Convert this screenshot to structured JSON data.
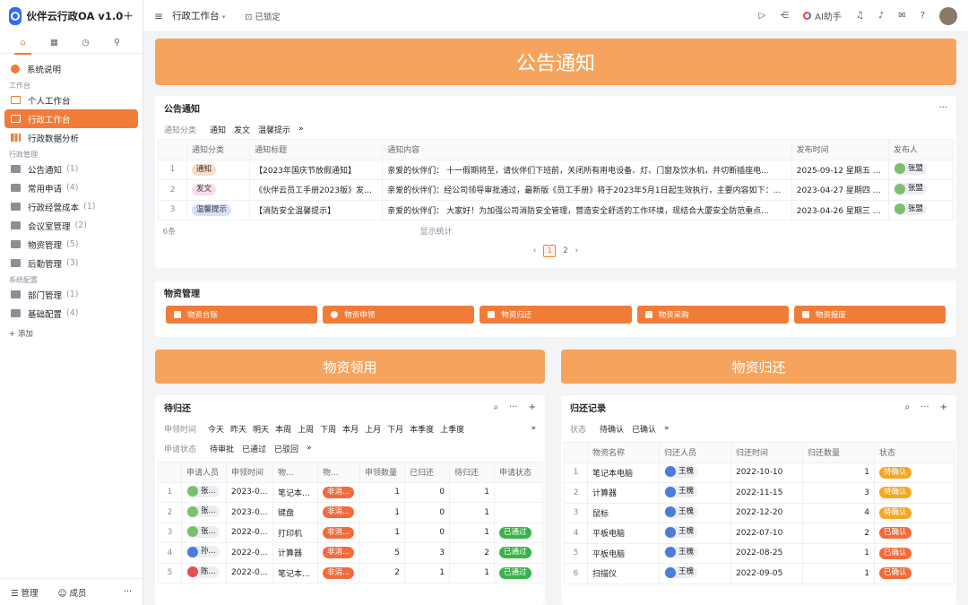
{
  "app": {
    "title": "伙伴云行政OA v1.0"
  },
  "sidebar": {
    "items": [
      {
        "label": "系统说明",
        "count": ""
      },
      {
        "label": "个人工作台",
        "count": ""
      },
      {
        "label": "行政工作台",
        "count": ""
      },
      {
        "label": "行政数据分析",
        "count": ""
      },
      {
        "label": "公告通知",
        "count": "(1)"
      },
      {
        "label": "常用申请",
        "count": "(4)"
      },
      {
        "label": "行政经营成本",
        "count": "(1)"
      },
      {
        "label": "会议室管理",
        "count": "(2)"
      },
      {
        "label": "物资管理",
        "count": "(5)"
      },
      {
        "label": "后勤管理",
        "count": "(3)"
      },
      {
        "label": "部门管理",
        "count": "(1)"
      },
      {
        "label": "基础配置",
        "count": "(4)"
      }
    ],
    "sections": [
      "工作台",
      "行政管理",
      "系统配置"
    ],
    "add": "+ 添加",
    "footer": {
      "manage": "管理",
      "members": "成员",
      "more": "···"
    }
  },
  "topbar": {
    "title": "行政工作台",
    "lock": "已锁定",
    "ai": "AI助手"
  },
  "banners": {
    "notice": "公告通知",
    "receive": "物资领用",
    "return": "物资归还"
  },
  "notice": {
    "title": "公告通知",
    "more": "···",
    "filter_label": "通知分类",
    "filters": [
      "通知",
      "发文",
      "温馨提示"
    ],
    "chev": "»",
    "headers": [
      "通知分类",
      "通知标题",
      "通知内容",
      "发布时间",
      "发布人"
    ],
    "rows": [
      {
        "n": "1",
        "cat": "通知",
        "title": "【2023年国庆节放假通知】",
        "content": "亲爱的伙伴们：     十一假期将至，请伙伴们下班前，关闭所有用电设备、灯、门窗及饮水机，并切断插座电...",
        "time": "2025-09-12 星期五 0...",
        "user": "张盟"
      },
      {
        "n": "2",
        "cat": "发文",
        "title": "《伙伴云员工手册2023版》发布...",
        "content": "亲爱的伙伴们：经公司领导审批通过，最新版《员工手册》将于2023年5月1日起生效执行，主要内容如下：...",
        "time": "2023-04-27 星期四 1...",
        "user": "张盟"
      },
      {
        "n": "3",
        "cat": "温馨提示",
        "title": "【消防安全温馨提示】",
        "content": "亲爱的伙伴们：     大家好！为加强公司消防安全管理，营造安全舒适的工作环境，现结合大厦安全防范重点...",
        "time": "2023-04-26 星期三 1...",
        "user": "张盟"
      }
    ],
    "footer_count": "6条",
    "footer_stats": "显示统计",
    "pages": [
      "‹",
      "1",
      "2",
      "›"
    ]
  },
  "materials": {
    "title": "物资管理",
    "buttons": [
      "物资台账",
      "物资申领",
      "物资归还",
      "物资采购",
      "物资报废"
    ]
  },
  "pending": {
    "title": "待归还",
    "time_label": "申领时间",
    "time_filters": [
      "今天",
      "昨天",
      "明天",
      "本周",
      "上周",
      "下周",
      "本月",
      "上月",
      "下月",
      "本季度",
      "上季度"
    ],
    "status_label": "申请状态",
    "status_filters": [
      "待审批",
      "已通过",
      "已驳回"
    ],
    "chev": "»",
    "headers": [
      "申请人员",
      "申领时间",
      "物...",
      "物...",
      "申领数量",
      "已归还",
      "待归还",
      "申请状态"
    ],
    "rows": [
      {
        "n": "1",
        "user": "张...",
        "time": "2023-0...",
        "item": "笔记本...",
        "kind": "非消...",
        "qty": "1",
        "ret": "0",
        "wait": "1",
        "status": ""
      },
      {
        "n": "2",
        "user": "张...",
        "time": "2023-0...",
        "item": "键盘",
        "kind": "非消...",
        "qty": "1",
        "ret": "0",
        "wait": "1",
        "status": ""
      },
      {
        "n": "3",
        "user": "张...",
        "time": "2022-0...",
        "item": "打印机",
        "kind": "非消...",
        "qty": "1",
        "ret": "0",
        "wait": "1",
        "status": "已通过"
      },
      {
        "n": "4",
        "user": "孙...",
        "time": "2022-0...",
        "item": "计算器",
        "kind": "非消...",
        "qty": "5",
        "ret": "3",
        "wait": "2",
        "status": "已通过"
      },
      {
        "n": "5",
        "user": "陈...",
        "time": "2022-0...",
        "item": "笔记本...",
        "kind": "非消...",
        "qty": "2",
        "ret": "1",
        "wait": "1",
        "status": "已通过"
      }
    ]
  },
  "records": {
    "title": "归还记录",
    "status_label": "状态",
    "status_filters": [
      "待确认",
      "已确认"
    ],
    "chev": "»",
    "headers": [
      "物资名称",
      "归还人员",
      "归还时间",
      "归还数量",
      "状态"
    ],
    "rows": [
      {
        "n": "1",
        "item": "笔记本电脑",
        "user": "王槐",
        "time": "2022-10-10",
        "qty": "1",
        "status": "待确认"
      },
      {
        "n": "2",
        "item": "计算器",
        "user": "王槐",
        "time": "2022-11-15",
        "qty": "3",
        "status": "待确认"
      },
      {
        "n": "3",
        "item": "鼠标",
        "user": "王槐",
        "time": "2022-12-20",
        "qty": "4",
        "status": "待确认"
      },
      {
        "n": "4",
        "item": "平板电脑",
        "user": "王槐",
        "time": "2022-07-10",
        "qty": "2",
        "status": "已确认"
      },
      {
        "n": "5",
        "item": "平板电脑",
        "user": "王槐",
        "time": "2022-08-25",
        "qty": "1",
        "status": "已确认"
      },
      {
        "n": "6",
        "item": "扫描仪",
        "user": "王槐",
        "time": "2022-09-05",
        "qty": "1",
        "status": "已确认"
      }
    ]
  },
  "colors": {
    "accent": "#f07c38",
    "banner": "#f6a45d",
    "approved": "#3bb34a",
    "pending": "#f5a623"
  }
}
